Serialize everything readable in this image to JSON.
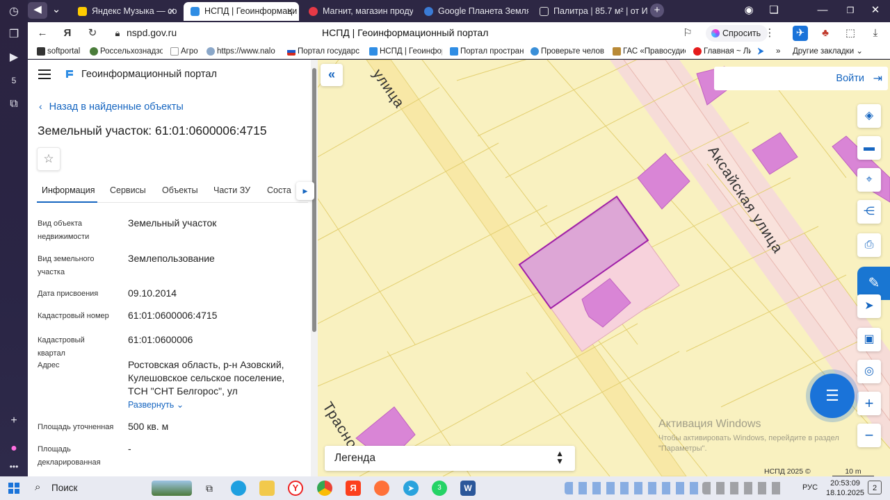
{
  "browser": {
    "tabs": [
      {
        "title": "Яндекс Музыка — со",
        "active": false
      },
      {
        "title": "НСПД | Геоинформаци",
        "active": true
      },
      {
        "title": "Магнит, магазин продукт",
        "active": false
      },
      {
        "title": "Google Планета Земля",
        "active": false
      },
      {
        "title": "Палитра | 85.7 м² | от ИП",
        "active": false
      }
    ],
    "url": "nspd.gov.ru",
    "page_title": "НСПД | Геоинформационный портал",
    "ask_label": "Спросить",
    "bookmarks": [
      "softportal",
      "Россельхознадзо",
      "Агро",
      "https://www.nalo",
      "Портал государс",
      "НСПД | Геоинфор",
      "Портал простран",
      "Проверьте челов",
      "ГАС «Правосудие",
      "Главная ~ Лич"
    ],
    "other_bookmarks": "Другие закладки",
    "more_bookmarks": "»"
  },
  "panel": {
    "portal_name": "Геоинформационный портал",
    "back_link": "Назад в найденные объекты",
    "object_title": "Земельный участок: 61:01:0600006:4715",
    "tabs": [
      "Информация",
      "Сервисы",
      "Объекты",
      "Части ЗУ",
      "Соста"
    ],
    "rows": [
      {
        "label": "Вид объекта недвижимости",
        "value": "Земельный участок"
      },
      {
        "label": "Вид земельного участка",
        "value": "Землепользование"
      },
      {
        "label": "Дата присвоения",
        "value": "09.10.2014"
      },
      {
        "label": "Кадастровый номер",
        "value": "61:01:0600006:4715"
      },
      {
        "label": "Кадастровый квартал",
        "value": "61:01:0600006"
      },
      {
        "label": "Адрес",
        "value": "Ростовская область, р-н Азовский, Кулешовское сельское поселение, ТСН \"СНТ Белгорос\", ул"
      },
      {
        "label": "Площадь уточненная",
        "value": "500 кв. м"
      },
      {
        "label": "Площадь декларированная",
        "value": "-"
      }
    ],
    "expand_label": "Развернуть"
  },
  "map": {
    "login_label": "Войти",
    "streets": [
      "улица",
      "Аксайская улица",
      "Трасно"
    ],
    "legend_label": "Легенда",
    "copyright": "НСПД 2025 ©",
    "scale": "10 m",
    "activation_title": "Активация Windows",
    "activation_text": "Чтобы активировать Windows, перейдите в раздел \"Параметры\".",
    "colors": {
      "base": "#f9f1c0",
      "road": "#f7e59a",
      "parcel_line": "#e6d37a",
      "building": "#d985d6",
      "selected": "#a020a8"
    }
  },
  "taskbar": {
    "search_label": "Поиск",
    "language": "РУС",
    "time": "20:53:09",
    "date": "18.10.2025",
    "notifications": "2",
    "whatsapp_badge": "3"
  }
}
